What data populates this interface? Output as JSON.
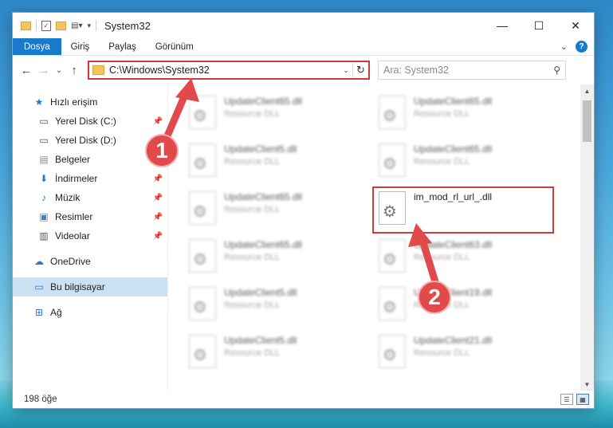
{
  "window": {
    "title": "System32",
    "minimize": "—",
    "maximize": "☐",
    "close": "✕"
  },
  "ribbon": {
    "tabs": [
      "Dosya",
      "Giriş",
      "Paylaş",
      "Görünüm"
    ],
    "expand": "⌄",
    "help": "?"
  },
  "nav": {
    "back": "←",
    "forward": "→",
    "recent": "⌄",
    "up": "↑"
  },
  "address": {
    "path": "C:\\Windows\\System32",
    "dropdown": "⌄",
    "refresh": "↻"
  },
  "search": {
    "placeholder": "Ara: System32",
    "icon": "search-icon"
  },
  "sidebar": {
    "items": [
      {
        "label": "Hızlı erişim",
        "icon": "star-icon"
      },
      {
        "label": "Yerel Disk (C:)",
        "icon": "drive-icon"
      },
      {
        "label": "Yerel Disk (D:)",
        "icon": "drive-icon"
      },
      {
        "label": "Belgeler",
        "icon": "documents-icon"
      },
      {
        "label": "İndirmeler",
        "icon": "download-icon"
      },
      {
        "label": "Müzik",
        "icon": "music-icon"
      },
      {
        "label": "Resimler",
        "icon": "pictures-icon"
      },
      {
        "label": "Videolar",
        "icon": "videos-icon"
      },
      {
        "label": "OneDrive",
        "icon": "cloud-icon"
      },
      {
        "label": "Bu bilgisayar",
        "icon": "computer-icon"
      },
      {
        "label": "Ağ",
        "icon": "network-icon"
      }
    ]
  },
  "files": [
    {
      "name": "UpdateClient65.dll",
      "type": "Resource DLL"
    },
    {
      "name": "UpdateClient65.dll",
      "type": "Resource DLL"
    },
    {
      "name": "UpdateClient5.dll",
      "type": "Resource DLL"
    },
    {
      "name": "UpdateClient65.dll",
      "type": "Resource DLL"
    },
    {
      "name": "UpdateClient65.dll",
      "type": "Resource DLL"
    },
    {
      "name": "im_mod_rl_url_.dll",
      "type": ""
    },
    {
      "name": "UpdateClient65.dll",
      "type": "Resource DLL"
    },
    {
      "name": "UpdateClient63.dll",
      "type": "Resource DLL"
    },
    {
      "name": "UpdateClient5.dll",
      "type": "Resource DLL"
    },
    {
      "name": "UpdateClient19.dll",
      "type": "Resource DLL"
    },
    {
      "name": "UpdateClient5.dll",
      "type": "Resource DLL"
    },
    {
      "name": "UpdateClient21.dll",
      "type": "Resource DLL"
    }
  ],
  "status": {
    "count": "198 öğe"
  },
  "annotations": {
    "step1": "1",
    "step2": "2",
    "color": "#e04a4a"
  }
}
